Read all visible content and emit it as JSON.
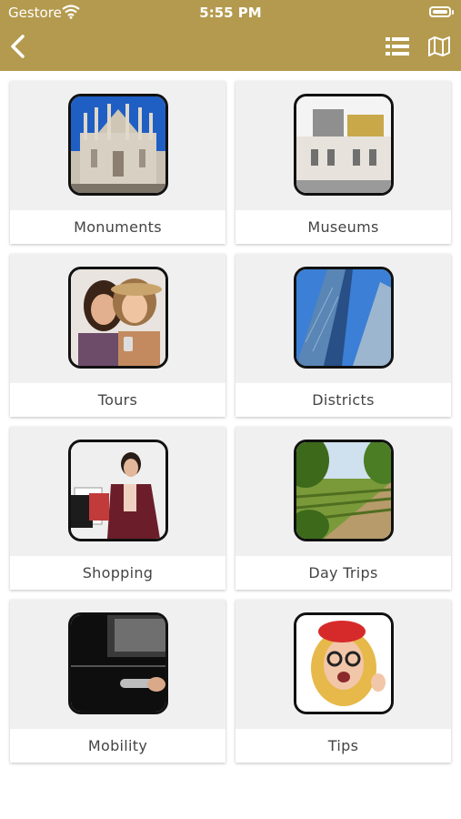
{
  "status_bar": {
    "carrier": "Gestore",
    "time": "5:55 PM"
  },
  "nav": {
    "back_icon": "chevron-left-icon",
    "list_icon": "list-icon",
    "map_icon": "map-icon",
    "bar_color": "#b49a4e"
  },
  "categories": [
    {
      "label": "Monuments",
      "image": "cathedral-photo"
    },
    {
      "label": "Museums",
      "image": "museum-building-photo"
    },
    {
      "label": "Tours",
      "image": "two-women-smiling-photo"
    },
    {
      "label": "Districts",
      "image": "glass-skyscrapers-photo"
    },
    {
      "label": "Shopping",
      "image": "woman-with-shopping-bags-photo"
    },
    {
      "label": "Day Trips",
      "image": "vineyard-landscape-photo"
    },
    {
      "label": "Mobility",
      "image": "car-door-handle-photo"
    },
    {
      "label": "Tips",
      "image": "woman-red-cap-glasses-photo"
    }
  ]
}
